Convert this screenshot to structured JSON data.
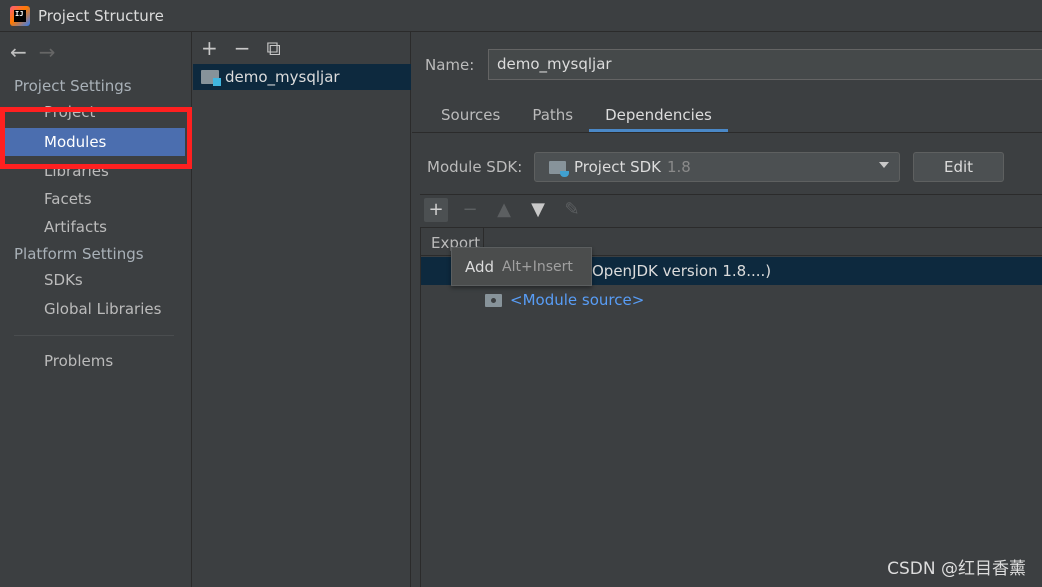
{
  "window": {
    "title": "Project Structure"
  },
  "nav": {
    "back": "←",
    "forward": "→"
  },
  "sidebar": {
    "project_settings_header": "Project Settings",
    "project_settings_items": [
      "Project",
      "Modules",
      "Libraries",
      "Facets",
      "Artifacts"
    ],
    "platform_settings_header": "Platform Settings",
    "platform_settings_items": [
      "SDKs",
      "Global Libraries"
    ],
    "problems": "Problems",
    "selected": "Modules"
  },
  "module_pane": {
    "toolbar": {
      "add": "+",
      "remove": "−",
      "copy": "⧉"
    },
    "modules": [
      "demo_mysqljar"
    ]
  },
  "content": {
    "name_label": "Name:",
    "name_value": "demo_mysqljar",
    "tabs": [
      "Sources",
      "Paths",
      "Dependencies"
    ],
    "active_tab": "Dependencies",
    "sdk_label": "Module SDK:",
    "sdk_value": "Project SDK",
    "sdk_version": "1.8",
    "edit_label": "Edit",
    "deps_toolbar": {
      "add": "+",
      "remove": "−",
      "up": "▲",
      "down": "▼",
      "edit": "✎"
    },
    "table": {
      "export_header": "Export",
      "sdk_row": "OpenJDK version 1.8....)",
      "source_row": "<Module source>"
    },
    "tooltip": {
      "action": "Add",
      "shortcut": "Alt+Insert"
    }
  },
  "watermark": "CSDN @红目香薰",
  "colors": {
    "selection": "#4b6eaf",
    "row_selection": "#0d293e",
    "highlight": "#ff2020",
    "link": "#589df6"
  }
}
